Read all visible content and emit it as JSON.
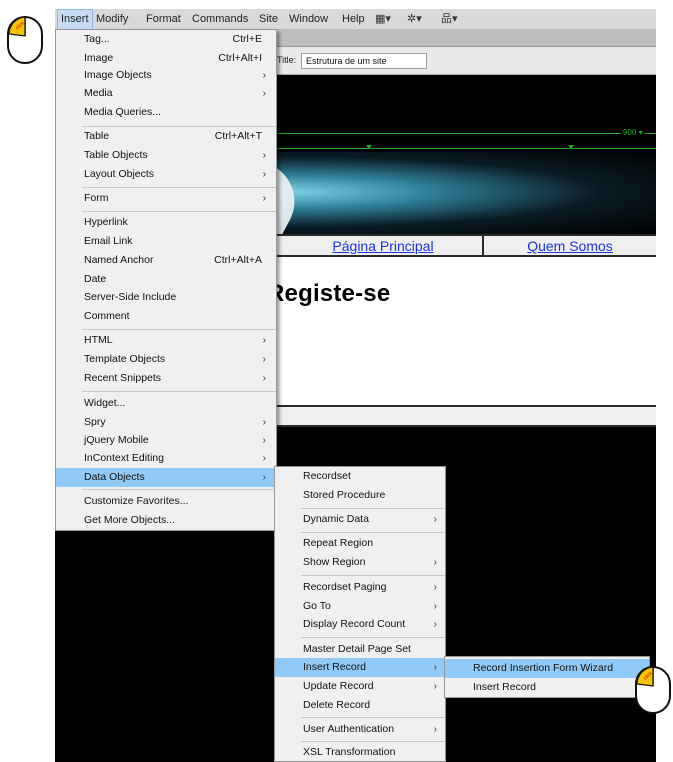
{
  "menubar": {
    "items": [
      {
        "label": "Insert"
      },
      {
        "label": "Modify"
      },
      {
        "label": "Format"
      },
      {
        "label": "Commands"
      },
      {
        "label": "Site"
      },
      {
        "label": "Window"
      },
      {
        "label": "Help"
      }
    ],
    "icons": [
      {
        "name": "layout-mode-icon",
        "glyph": "▦▾"
      },
      {
        "name": "extensions-gear-icon",
        "glyph": "✲▾"
      },
      {
        "name": "site-manage-icon",
        "glyph": "品▾"
      }
    ]
  },
  "document": {
    "title_label": "Title:",
    "title_value": "Estrutura de um site",
    "width_badge": "900 ▾",
    "nav_links": [
      "Página Principal",
      "Quem Somos"
    ],
    "heading": "Registe-se"
  },
  "insert_menu": {
    "items": [
      {
        "label": "Tag...",
        "shortcut": "Ctrl+E",
        "submenu": false
      },
      {
        "label": "Image",
        "shortcut": "Ctrl+Alt+I",
        "submenu": false
      },
      {
        "label": "Image Objects",
        "shortcut": "",
        "submenu": true
      },
      {
        "label": "Media",
        "shortcut": "",
        "submenu": true
      },
      {
        "label": "Media Queries...",
        "shortcut": "",
        "submenu": false
      },
      {
        "label": "Table",
        "shortcut": "Ctrl+Alt+T",
        "submenu": false
      },
      {
        "label": "Table Objects",
        "shortcut": "",
        "submenu": true
      },
      {
        "label": "Layout Objects",
        "shortcut": "",
        "submenu": true
      },
      {
        "label": "Form",
        "shortcut": "",
        "submenu": true
      },
      {
        "label": "Hyperlink",
        "shortcut": "",
        "submenu": false
      },
      {
        "label": "Email Link",
        "shortcut": "",
        "submenu": false
      },
      {
        "label": "Named Anchor",
        "shortcut": "Ctrl+Alt+A",
        "submenu": false
      },
      {
        "label": "Date",
        "shortcut": "",
        "submenu": false
      },
      {
        "label": "Server-Side Include",
        "shortcut": "",
        "submenu": false
      },
      {
        "label": "Comment",
        "shortcut": "",
        "submenu": false
      },
      {
        "label": "HTML",
        "shortcut": "",
        "submenu": true
      },
      {
        "label": "Template Objects",
        "shortcut": "",
        "submenu": true
      },
      {
        "label": "Recent Snippets",
        "shortcut": "",
        "submenu": true
      },
      {
        "label": "Widget...",
        "shortcut": "",
        "submenu": false
      },
      {
        "label": "Spry",
        "shortcut": "",
        "submenu": true
      },
      {
        "label": "jQuery Mobile",
        "shortcut": "",
        "submenu": true
      },
      {
        "label": "InContext Editing",
        "shortcut": "",
        "submenu": true
      },
      {
        "label": "Data Objects",
        "shortcut": "",
        "submenu": true,
        "highlighted": true
      },
      {
        "label": "Customize Favorites...",
        "shortcut": "",
        "submenu": false
      },
      {
        "label": "Get More Objects...",
        "shortcut": "",
        "submenu": false
      }
    ]
  },
  "data_objects_menu": {
    "items": [
      {
        "label": "Recordset",
        "submenu": false
      },
      {
        "label": "Stored Procedure",
        "submenu": false
      },
      {
        "label": "Dynamic Data",
        "submenu": true
      },
      {
        "label": "Repeat Region",
        "submenu": false
      },
      {
        "label": "Show Region",
        "submenu": true
      },
      {
        "label": "Recordset Paging",
        "submenu": true
      },
      {
        "label": "Go To",
        "submenu": true
      },
      {
        "label": "Display Record Count",
        "submenu": true
      },
      {
        "label": "Master Detail Page Set",
        "submenu": false
      },
      {
        "label": "Insert Record",
        "submenu": true,
        "highlighted": true
      },
      {
        "label": "Update Record",
        "submenu": true
      },
      {
        "label": "Delete Record",
        "submenu": false
      },
      {
        "label": "User Authentication",
        "submenu": true
      },
      {
        "label": "XSL Transformation",
        "submenu": false
      }
    ]
  },
  "insert_record_menu": {
    "items": [
      {
        "label": "Record Insertion Form Wizard",
        "highlighted": true
      },
      {
        "label": "Insert Record"
      }
    ]
  },
  "cursor_labels": [
    "click",
    "click"
  ],
  "colors": {
    "menu_highlight": "#91c9f7",
    "menubar_active": "#c6dcf5",
    "link_blue": "#1a33dd",
    "guide_green": "#22aa22"
  }
}
